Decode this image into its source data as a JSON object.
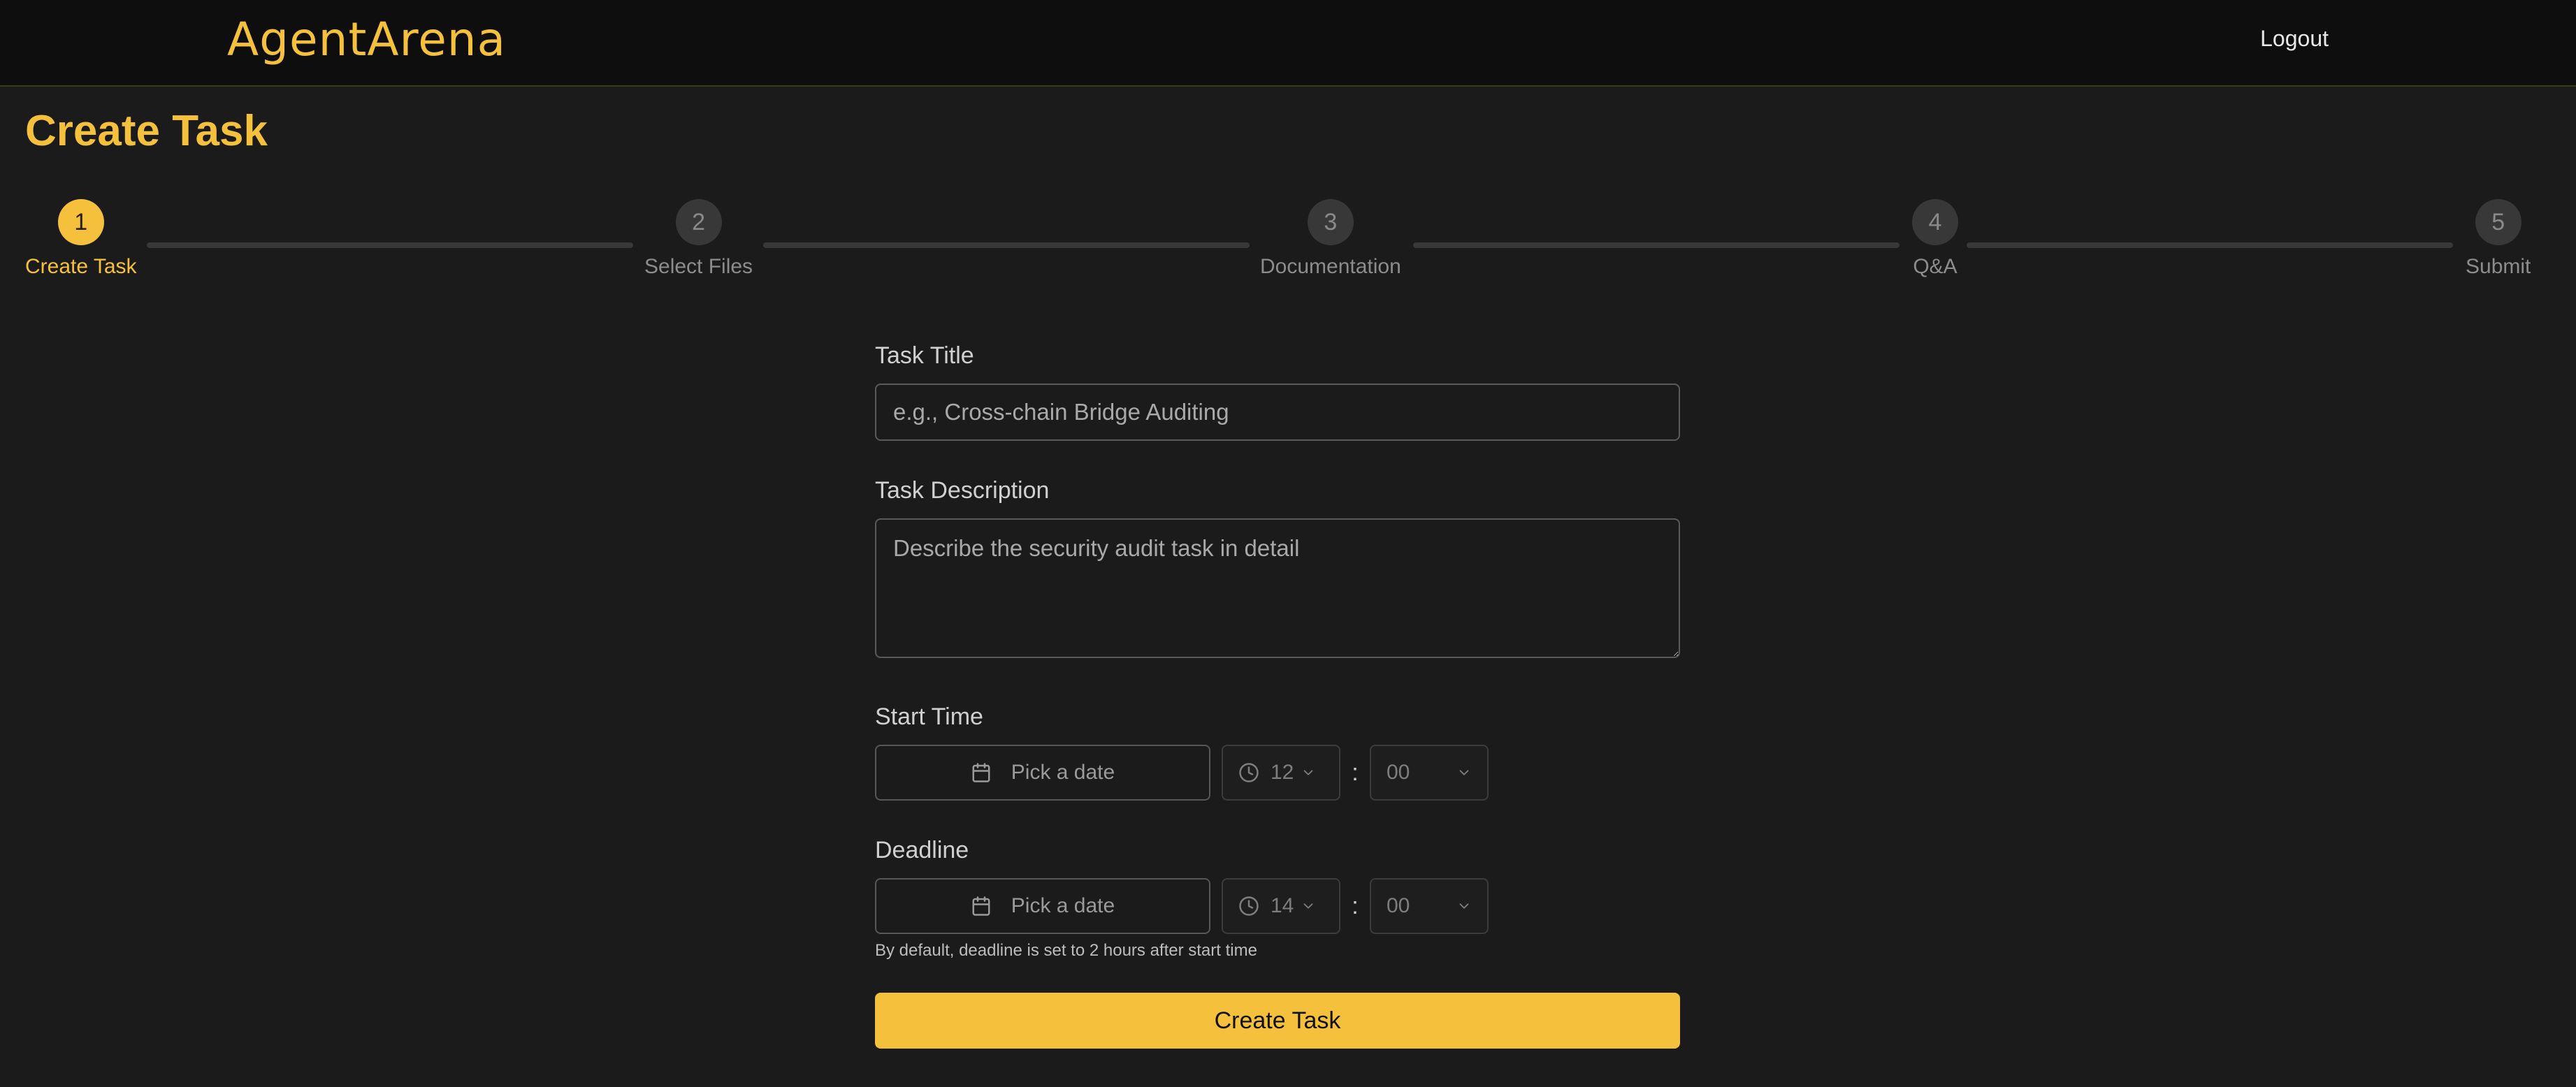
{
  "header": {
    "logo": "AgentArena",
    "logout_label": "Logout"
  },
  "page": {
    "title": "Create Task"
  },
  "stepper": {
    "steps": [
      {
        "number": "1",
        "label": "Create Task",
        "active": true
      },
      {
        "number": "2",
        "label": "Select Files",
        "active": false
      },
      {
        "number": "3",
        "label": "Documentation",
        "active": false
      },
      {
        "number": "4",
        "label": "Q&A",
        "active": false
      },
      {
        "number": "5",
        "label": "Submit",
        "active": false
      }
    ]
  },
  "form": {
    "title_label": "Task Title",
    "title_placeholder": "e.g., Cross-chain Bridge Auditing",
    "description_label": "Task Description",
    "description_placeholder": "Describe the security audit task in detail",
    "start_time": {
      "label": "Start Time",
      "date_placeholder": "Pick a date",
      "hour": "12",
      "minute": "00"
    },
    "deadline": {
      "label": "Deadline",
      "date_placeholder": "Pick a date",
      "hour": "14",
      "minute": "00",
      "hint": "By default, deadline is set to 2 hours after start time"
    },
    "colon": ":",
    "submit_label": "Create Task"
  },
  "colors": {
    "accent": "#f5c13c",
    "background": "#1b1b1b",
    "header_background": "#0e0e0e"
  },
  "icons": [
    "calendar-icon",
    "clock-icon",
    "chevron-down-icon"
  ]
}
